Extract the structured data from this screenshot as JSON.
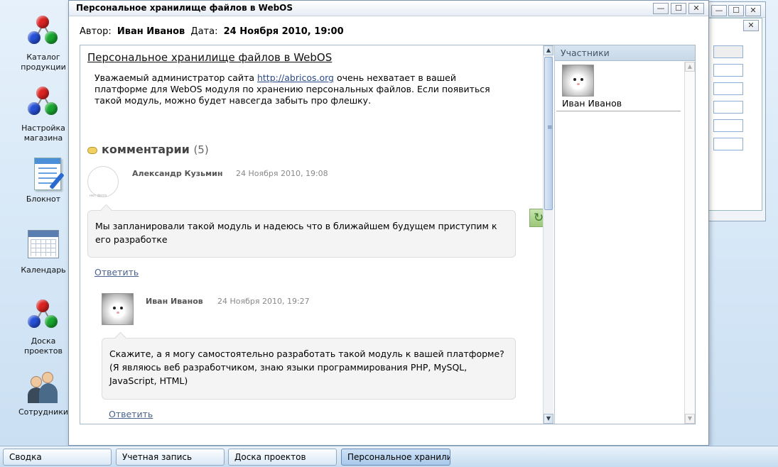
{
  "desktop": {
    "icons": [
      {
        "label": "Каталог\nпродукции",
        "icon": "molecule-icon"
      },
      {
        "label": "Настройка\nмагазина",
        "icon": "molecule-icon"
      },
      {
        "label": "Блокнот",
        "icon": "notepad-icon"
      },
      {
        "label": "Календарь",
        "icon": "calendar-icon"
      },
      {
        "label": "Доска\nпроектов",
        "icon": "molecule-icon"
      },
      {
        "label": "Сотрудники",
        "icon": "people-icon"
      }
    ]
  },
  "window": {
    "title": "Персональное хранилище файлов в WebOS",
    "controls": {
      "minimize": "—",
      "maximize": "☐",
      "close": "✕"
    },
    "meta": {
      "author_label": "Автор:",
      "author": "Иван Иванов",
      "date_label": "Дата:",
      "date": "24 Ноября 2010, 19:00"
    },
    "post": {
      "title": "Персональное хранилище файлов в WebOS",
      "body_before_link": "Уважаемый администратор сайта ",
      "link": "http://abricos.org",
      "body_after_link": " очень нехватает в вашей платформе для WebOS модуля по хранению персональных файлов. Если появиться такой модуль, можно будет навсегда забыть про флешку."
    },
    "comments": {
      "label": "комментарии",
      "count": "(5)",
      "avatar_blank_text": "нет фото",
      "items": [
        {
          "author": "Александр Кузьмин",
          "date": "24 Ноября 2010, 19:08",
          "text": "Мы запланировали такой модуль и надеюсь что в ближайшем будущем приступим к его разработке",
          "reply": "Ответить"
        },
        {
          "author": "Иван Иванов",
          "date": "24 Ноября 2010, 19:27",
          "text": "Скажите, а я могу самостоятельно разработать такой модуль к вашей платформе? (Я являюсь веб разработчиком, знаю языки программирования PHP, MySQL, JavaScript, HTML)",
          "reply": "Ответить"
        }
      ]
    },
    "members": {
      "header": "Участники",
      "items": [
        {
          "name": "Иван Иванов"
        }
      ]
    }
  },
  "background_window": {
    "controls": {
      "minimize": "—",
      "maximize": "☐",
      "close": "✕"
    }
  },
  "taskbar": {
    "items": [
      {
        "label": "Сводка",
        "active": false
      },
      {
        "label": "Учетная запись",
        "active": false
      },
      {
        "label": "Доска проектов",
        "active": false
      },
      {
        "label": "Персональное хранили",
        "active": true
      }
    ]
  }
}
